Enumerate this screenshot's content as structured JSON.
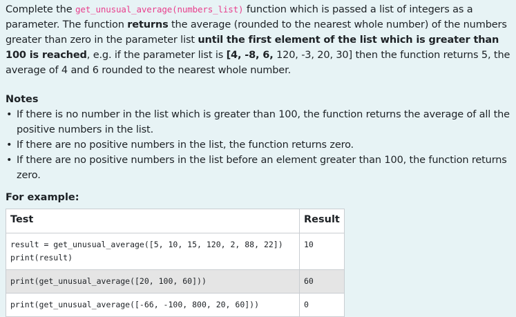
{
  "intro": {
    "t1": "Complete the ",
    "func_code": "get_unusual_average(numbers_list)",
    "t2": " function which is passed a list of  integers as a parameter. The function ",
    "b1": "returns",
    "t3": " the average (rounded to the nearest whole number) of the numbers greater than zero in the parameter list ",
    "b2": "until the first element of the list which is greater than 100 is reached",
    "t4": ", e.g. if the parameter list is ",
    "b3": "[4, -8, 6,",
    "t5": " 120, -3, 20, 30] then the function returns 5, the average of 4 and 6 rounded to the nearest whole number."
  },
  "notes": {
    "heading": "Notes",
    "items": [
      "If there is no number in the list which is greater than 100, the function returns the average of all the positive numbers in the list.",
      "If there are no positive numbers in the list, the function returns zero.",
      "If there are no positive numbers in the list before an element greater than 100, the function returns zero."
    ]
  },
  "example": {
    "heading": "For example:",
    "headers": [
      "Test",
      "Result"
    ],
    "rows": [
      {
        "test": "result = get_unusual_average([5, 10, 15, 120, 2, 88, 22])\nprint(result)",
        "result": "10"
      },
      {
        "test": "print(get_unusual_average([20, 100, 60]))",
        "result": "60"
      },
      {
        "test": "print(get_unusual_average([-66, -100, 800, 20, 60]))",
        "result": "0"
      }
    ]
  }
}
